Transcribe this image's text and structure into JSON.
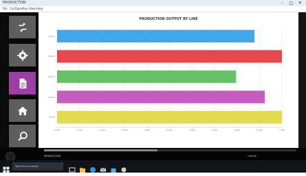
{
  "window": {
    "title": "PRODUCTION",
    "menu": [
      "File",
      "Configure",
      "Run",
      "View",
      "Help"
    ]
  },
  "sidebar": {
    "items": [
      {
        "name": "refresh",
        "icon": "shuffle-icon",
        "active": false
      },
      {
        "name": "settings",
        "icon": "gear-icon",
        "active": false
      },
      {
        "name": "report",
        "icon": "document-icon",
        "active": true
      },
      {
        "name": "home",
        "icon": "home-icon",
        "active": false
      },
      {
        "name": "search",
        "icon": "search-icon",
        "active": false
      }
    ]
  },
  "chart_data": {
    "type": "bar",
    "orientation": "horizontal",
    "title": "PRODUCTION OUTPUT BY LINE",
    "subtitle": "",
    "categories": [
      "Line 1",
      "Line 2",
      "Line 3",
      "Line 4",
      "Line 5"
    ],
    "values": [
      0.878,
      1.0,
      0.796,
      0.924,
      1.0
    ],
    "colors": [
      "#46a5e4",
      "#e6474d",
      "#62c467",
      "#c75bbf",
      "#e3da4b"
    ],
    "xlim": [
      0,
      1
    ],
    "xticks": [
      "0.000",
      "0.100",
      "0.200",
      "0.300",
      "0.400",
      "0.500",
      "0.600",
      "0.700",
      "0.800",
      "0.900",
      "1.000"
    ],
    "xlabel": "",
    "grid": true
  },
  "status": {
    "progress": 0.45,
    "left_text": "PRODUCTION",
    "right_text": "ONLINE"
  },
  "taskbar": {
    "search_placeholder": "Type here to search",
    "time": "",
    "icons": [
      "windows-icon",
      "task-view-icon",
      "file-explorer-icon",
      "browser-icon",
      "mail-icon",
      "store-icon",
      "app-icon"
    ]
  }
}
